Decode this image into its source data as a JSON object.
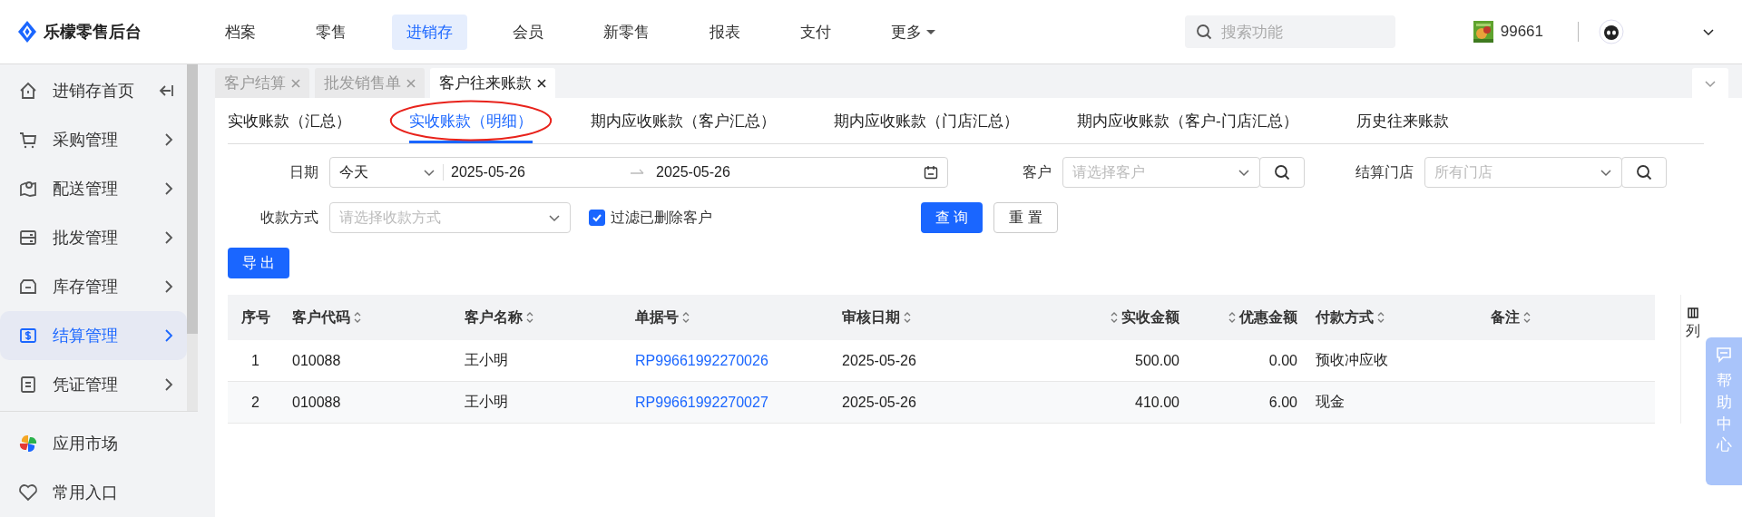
{
  "brand": {
    "name": "乐檬零售后台"
  },
  "top_nav": [
    {
      "label": "档案",
      "selected": false,
      "has_caret": false
    },
    {
      "label": "零售",
      "selected": false,
      "has_caret": false
    },
    {
      "label": "进销存",
      "selected": true,
      "has_caret": false
    },
    {
      "label": "会员",
      "selected": false,
      "has_caret": false
    },
    {
      "label": "新零售",
      "selected": false,
      "has_caret": false
    },
    {
      "label": "报表",
      "selected": false,
      "has_caret": false
    },
    {
      "label": "支付",
      "selected": false,
      "has_caret": false
    },
    {
      "label": "更多",
      "selected": false,
      "has_caret": true
    }
  ],
  "search": {
    "placeholder": "搜索功能"
  },
  "store": {
    "code": "99661"
  },
  "sidebar": {
    "items": [
      {
        "label": "进销存首页",
        "selected": false,
        "kind": "collapse"
      },
      {
        "label": "采购管理",
        "selected": false,
        "kind": "submenu"
      },
      {
        "label": "配送管理",
        "selected": false,
        "kind": "submenu"
      },
      {
        "label": "批发管理",
        "selected": false,
        "kind": "submenu"
      },
      {
        "label": "库存管理",
        "selected": false,
        "kind": "submenu"
      },
      {
        "label": "结算管理",
        "selected": true,
        "kind": "submenu"
      },
      {
        "label": "凭证管理",
        "selected": false,
        "kind": "submenu"
      }
    ],
    "bottom_items": [
      {
        "label": "应用市场"
      },
      {
        "label": "常用入口"
      }
    ]
  },
  "page_tabs": [
    {
      "label": "客户结算",
      "selected": false
    },
    {
      "label": "批发销售单",
      "selected": false
    },
    {
      "label": "客户往来账款",
      "selected": true
    }
  ],
  "sub_tabs": [
    {
      "label": "实收账款（汇总）",
      "selected": false,
      "circled": false
    },
    {
      "label": "实收账款（明细）",
      "selected": true,
      "circled": true
    },
    {
      "label": "期内应收账款（客户汇总）",
      "selected": false,
      "circled": false
    },
    {
      "label": "期内应收账款（门店汇总）",
      "selected": false,
      "circled": false
    },
    {
      "label": "期内应收账款（客户-门店汇总）",
      "selected": false,
      "circled": false
    },
    {
      "label": "历史往来账款",
      "selected": false,
      "circled": false
    }
  ],
  "filters": {
    "date": {
      "label": "日期",
      "preset": "今天",
      "start": "2025-05-26",
      "end": "2025-05-26"
    },
    "customer": {
      "label": "客户",
      "placeholder": "请选择客户"
    },
    "store": {
      "label": "结算门店",
      "placeholder": "所有门店"
    },
    "payment": {
      "label": "收款方式",
      "placeholder": "请选择收款方式"
    },
    "filter_deleted": {
      "label": "过滤已删除客户",
      "checked": true
    }
  },
  "buttons": {
    "query": "查 询",
    "reset": "重 置",
    "export": "导 出"
  },
  "table": {
    "columns": [
      {
        "label": "序号",
        "kind": "index"
      },
      {
        "label": "客户代码",
        "kind": "text"
      },
      {
        "label": "客户名称",
        "kind": "text"
      },
      {
        "label": "单据号",
        "kind": "link"
      },
      {
        "label": "审核日期",
        "kind": "text"
      },
      {
        "label": "实收金额",
        "kind": "number"
      },
      {
        "label": "优惠金额",
        "kind": "number"
      },
      {
        "label": "付款方式",
        "kind": "text"
      },
      {
        "label": "备注",
        "kind": "text"
      }
    ],
    "rows": [
      {
        "cells": [
          "1",
          "010088",
          "王小明",
          "RP99661992270026",
          "2025-05-26",
          "500.00",
          "0.00",
          "预收冲应收",
          ""
        ]
      },
      {
        "cells": [
          "2",
          "010088",
          "王小明",
          "RP99661992270027",
          "2025-05-26",
          "410.00",
          "6.00",
          "现金",
          ""
        ]
      }
    ]
  },
  "column_settings": {
    "label": "列"
  },
  "help": {
    "label": "帮助中心"
  }
}
